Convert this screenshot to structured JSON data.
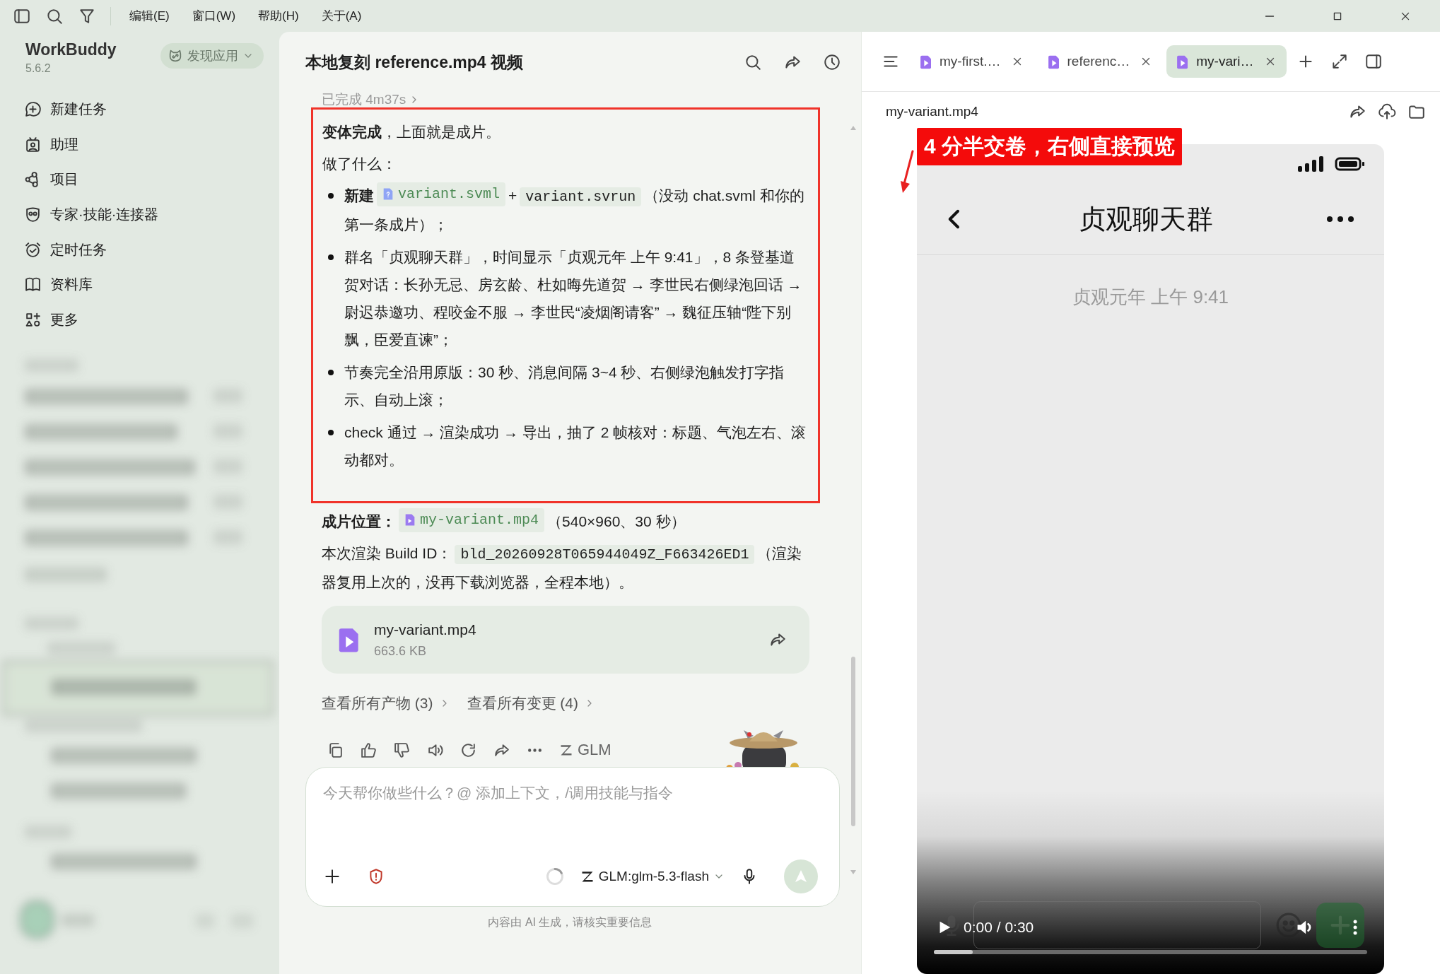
{
  "menu": {
    "items": [
      "编辑(E)",
      "窗口(W)",
      "帮助(H)",
      "关于(A)"
    ]
  },
  "sidebar": {
    "app_name": "WorkBuddy",
    "version": "5.6.2",
    "discover_button": "发现应用",
    "items": [
      {
        "label": "新建任务"
      },
      {
        "label": "助理"
      },
      {
        "label": "项目"
      },
      {
        "label": "专家·技能·连接器"
      },
      {
        "label": "定时任务"
      },
      {
        "label": "资料库"
      },
      {
        "label": "更多"
      }
    ]
  },
  "conversation": {
    "title": "本地复刻 reference.mp4 视频",
    "status": "已完成 4m37s",
    "summary": "**变体完成**，上面就是成片。",
    "heading": "做了什么：",
    "bullets": [
      [
        {
          "kind": "bold",
          "text": "新建"
        },
        {
          "kind": "file",
          "text": "variant.svml"
        },
        {
          "kind": "text",
          "text": "+"
        },
        {
          "kind": "code",
          "text": "variant.svrun"
        },
        {
          "kind": "text",
          "text": "（没动 chat.svml 和你的第一条成片）；"
        }
      ],
      [
        {
          "kind": "text",
          "text": "群名「贞观聊天群」，时间显示「贞观元年 上午 9:41」，8 条登基道贺对话：长孙无忌、房玄龄、杜如晦先道贺 → 李世民右侧绿泡回话 → 尉迟恭邀功、程咬金不服 → 李世民“凌烟阁请客” → 魏征压轴“陛下别飘，臣爱直谏”；"
        }
      ],
      [
        {
          "kind": "text",
          "text": "节奏完全沿用原版：30 秒、消息间隔 3~4 秒、右侧绿泡触发打字指示、自动上滚；"
        }
      ],
      [
        {
          "kind": "text",
          "text": "check 通过 → 渲染成功 → 导出，抽了 2 帧核对：标题、气泡左右、滚动都对。"
        }
      ]
    ],
    "paragraphs": [
      [
        {
          "kind": "bold",
          "text": "成片位置："
        },
        {
          "kind": "file",
          "text": "my-variant.mp4"
        },
        {
          "kind": "text",
          "text": "（540×960、30 秒）"
        }
      ],
      [
        {
          "kind": "text",
          "text": "本次渲染 Build ID："
        },
        {
          "kind": "code",
          "text": "bld_20260928T065944049Z_F663426ED1"
        },
        {
          "kind": "text",
          "text": "（渲染器复用上次的，没再下载浏览器，全程本地）。"
        }
      ]
    ],
    "attachment": {
      "name": "my-variant.mp4",
      "size": "663.6 KB"
    },
    "links": [
      "查看所有产物 (3)",
      "查看所有变更 (4)"
    ],
    "model_badge": "GLM"
  },
  "composer": {
    "placeholder": "今天帮你做些什么？@ 添加上下文，/调用技能与指令",
    "model": "GLM:glm-5.3-flash"
  },
  "footer": "内容由 AI 生成，请核实重要信息",
  "preview": {
    "tabs": [
      {
        "label": "my-first.…",
        "selected": false
      },
      {
        "label": "referenc…",
        "selected": false
      },
      {
        "label": "my-vari…",
        "selected": true
      }
    ],
    "filename": "my-variant.mp4",
    "video": {
      "chat_title": "贞观聊天群",
      "timestamp": "贞观元年 上午 9:41",
      "time": "0:00 / 0:30",
      "level": 0.09
    }
  },
  "annotation": "4 分半交卷，右侧直接预览"
}
